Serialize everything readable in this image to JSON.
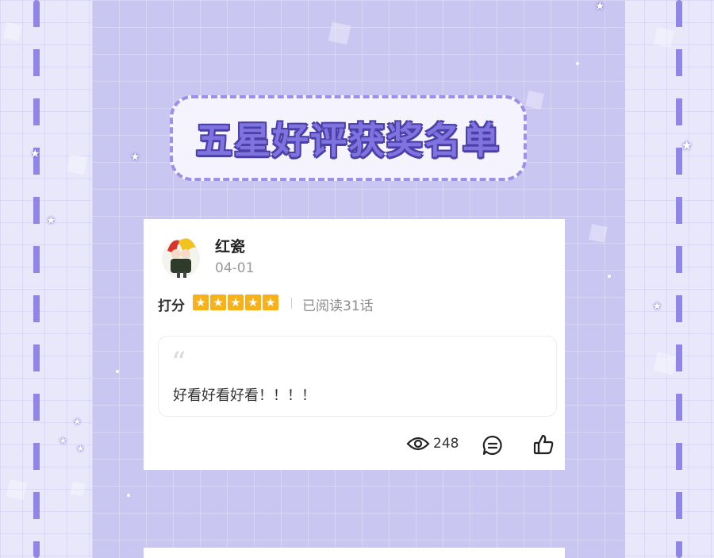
{
  "banner": {
    "title": "五星好评获奖名单"
  },
  "review": {
    "username": "红瓷",
    "date": "04-01",
    "rating_label": "打分",
    "stars": 5,
    "star_glyph": "★",
    "read_info": "已阅读31话",
    "quote_mark": "“",
    "comment": "好看好看好看！！！！",
    "view_count": "248"
  },
  "icons": [
    "star-icon",
    "eye-icon",
    "comment-icon",
    "thumbs-up-icon",
    "quote-icon"
  ],
  "colors": {
    "accent": "#8f86e8",
    "title_fill": "#7f73e0",
    "title_outline": "#4c3fa8",
    "star": "#f7b21b",
    "background": "#e9e8fb",
    "panel": "#c9c6f1"
  }
}
